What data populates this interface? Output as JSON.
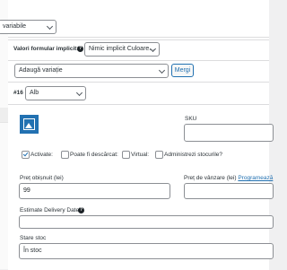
{
  "header": {
    "type_select": "variabile",
    "default_form_label": "Valori formular implicit:",
    "default_form_value": "Nimic implicit Culoare...",
    "add_variation_select": "Adaugă variație",
    "go_button": "Mergi"
  },
  "variation": {
    "number": "#16",
    "color_value": "Alb",
    "sku_label": "SKU",
    "enabled_label": "Activate:",
    "downloadable_label": "Poate fi descărcat:",
    "virtual_label": "Virtual:",
    "manage_stock_label": "Administrezi stocurile?",
    "enabled_checked": true,
    "downloadable_checked": false,
    "virtual_checked": false,
    "manage_stock_checked": false,
    "regular_price_label": "Preț obișnuit (lei)",
    "regular_price_value": "99",
    "sale_price_label": "Preț de vânzare (lei)",
    "schedule_link": "Programează",
    "estimate_delivery_label": "Estimate Delivery Date",
    "help_icon_text": "?",
    "stock_status_label": "Stare stoc",
    "stock_status_value": "În stoc"
  },
  "icons": {
    "image_placeholder": "image-placeholder-icon",
    "help": "help-icon"
  },
  "colors": {
    "accent": "#2271b1",
    "background": "#f0f0f1",
    "border": "#8c8f94"
  }
}
